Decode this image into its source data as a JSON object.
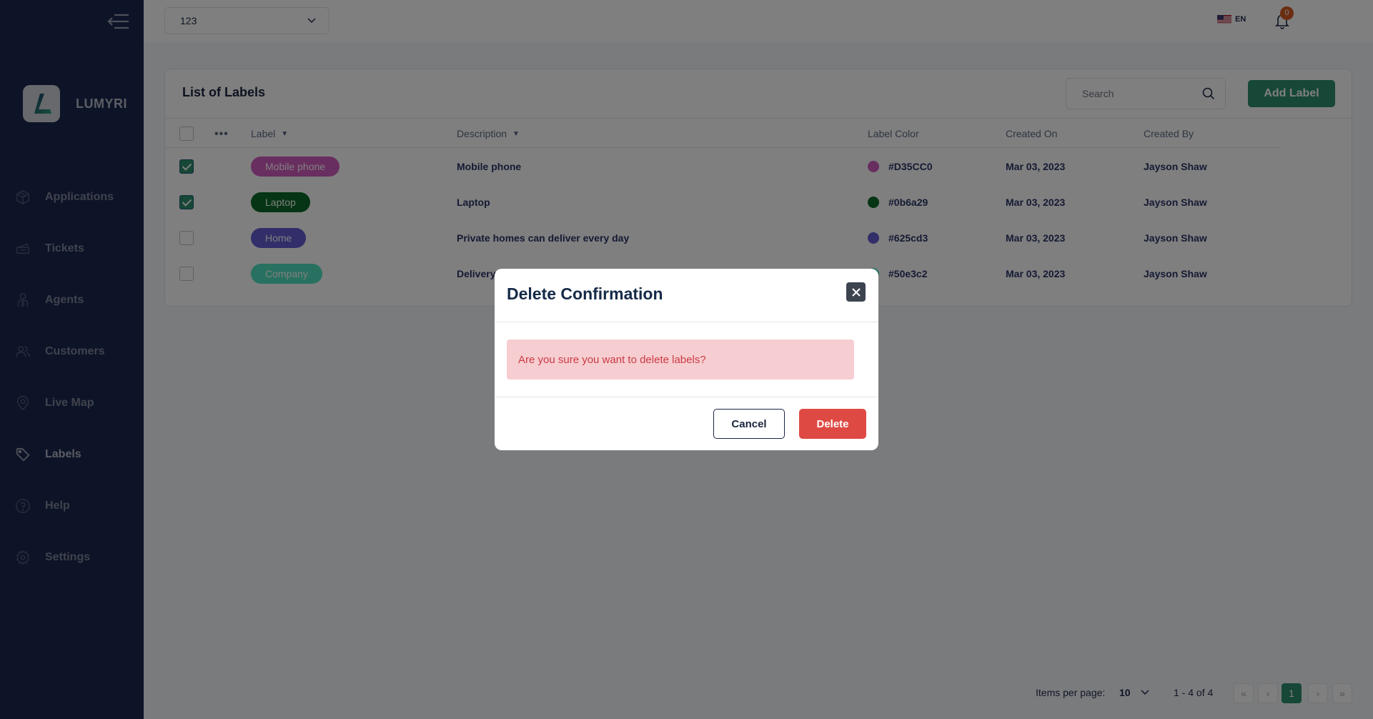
{
  "sidebar": {
    "brand": "LUMYRI",
    "items": [
      {
        "label": "Applications",
        "icon": "box-icon",
        "active": false
      },
      {
        "label": "Tickets",
        "icon": "ticket-icon",
        "active": false
      },
      {
        "label": "Agents",
        "icon": "agent-icon",
        "active": false
      },
      {
        "label": "Customers",
        "icon": "customers-icon",
        "active": false
      },
      {
        "label": "Live Map",
        "icon": "map-pin-icon",
        "active": false
      },
      {
        "label": "Labels",
        "icon": "tag-icon",
        "active": true
      },
      {
        "label": "Help",
        "icon": "help-icon",
        "active": false
      },
      {
        "label": "Settings",
        "icon": "gear-icon",
        "active": false
      }
    ]
  },
  "header": {
    "workspace_select": "123",
    "language": "EN",
    "notification_count": "0"
  },
  "card": {
    "title": "List of Labels",
    "search_placeholder": "Search",
    "add_button": "Add Label"
  },
  "table": {
    "columns": {
      "label": "Label",
      "description": "Description",
      "label_color": "Label Color",
      "created_on": "Created On",
      "created_by": "Created By"
    },
    "rows": [
      {
        "checked": true,
        "label": "Mobile phone",
        "pill_color": "#D35CC0",
        "description": "Mobile phone",
        "color_hex": "#D35CC0",
        "created_on": "Mar 03, 2023",
        "created_by": "Jayson Shaw"
      },
      {
        "checked": true,
        "label": "Laptop",
        "pill_color": "#0b6a29",
        "description": "Laptop",
        "color_hex": "#0b6a29",
        "created_on": "Mar 03, 2023",
        "created_by": "Jayson Shaw"
      },
      {
        "checked": false,
        "label": "Home",
        "pill_color": "#625cd3",
        "description": "Private homes can deliver every day",
        "color_hex": "#625cd3",
        "created_on": "Mar 03, 2023",
        "created_by": "Jayson Shaw"
      },
      {
        "checked": false,
        "label": "Company",
        "pill_color": "#50e3c2",
        "description": "Delivery schedule is affected",
        "color_hex": "#50e3c2",
        "created_on": "Mar 03, 2023",
        "created_by": "Jayson Shaw"
      }
    ]
  },
  "pagination": {
    "items_per_page_label": "Items per page:",
    "items_per_page": "10",
    "range": "1 - 4 of 4",
    "first": "«",
    "prev": "‹",
    "current_page": "1",
    "next": "›",
    "last": "»"
  },
  "modal": {
    "title": "Delete Confirmation",
    "message": "Are you sure you want to delete labels?",
    "cancel": "Cancel",
    "delete": "Delete"
  },
  "colors": {
    "sidebar_bg": "#1c2951",
    "accent": "#2d8f6f",
    "danger": "#de4a43",
    "notification": "#d65a25"
  }
}
